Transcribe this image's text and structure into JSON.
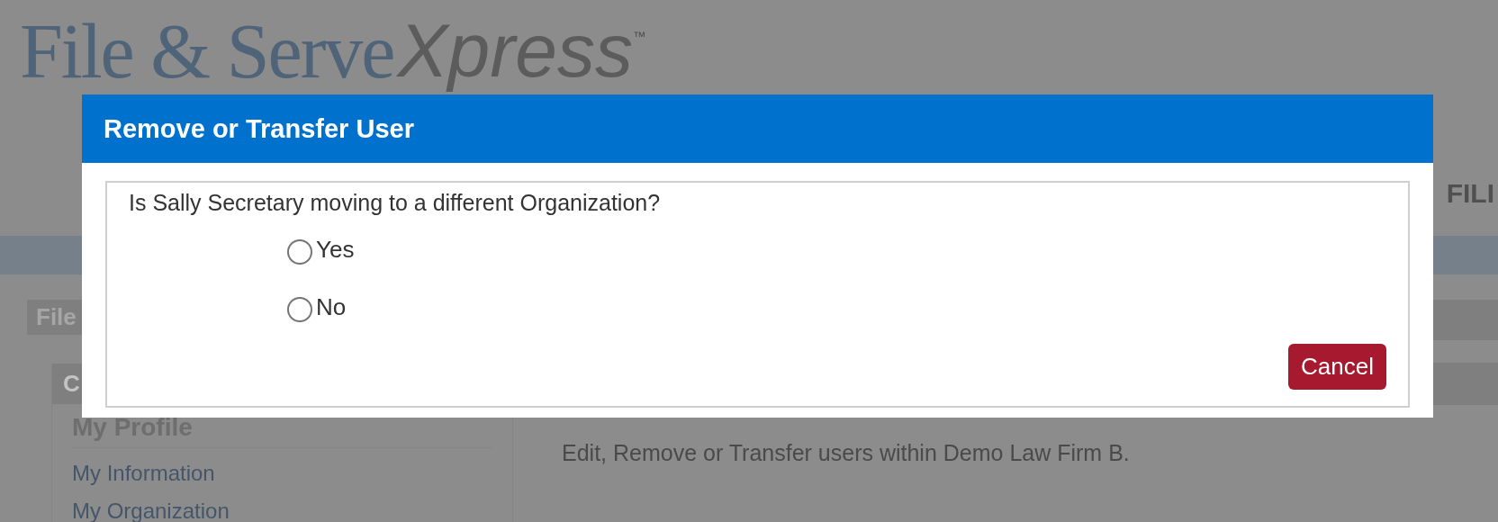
{
  "page": {
    "logo": {
      "main": "File & Serve",
      "accent": "Xpress",
      "mark": "™"
    },
    "nav": {
      "item": "FILI"
    },
    "sidebar": {
      "title": "File",
      "section_title": "C",
      "heading": "My Profile",
      "links": [
        "My Information",
        "My Organization"
      ]
    },
    "content": {
      "description": "Edit, Remove or Transfer users within Demo Law Firm B."
    }
  },
  "dialog": {
    "title": "Remove or Transfer User",
    "question": "Is Sally Secretary moving to a different Organization?",
    "options": [
      {
        "label": "Yes",
        "selected": false
      },
      {
        "label": "No",
        "selected": false
      }
    ],
    "buttons": [
      {
        "label": "Cancel",
        "kind": "danger"
      }
    ]
  }
}
